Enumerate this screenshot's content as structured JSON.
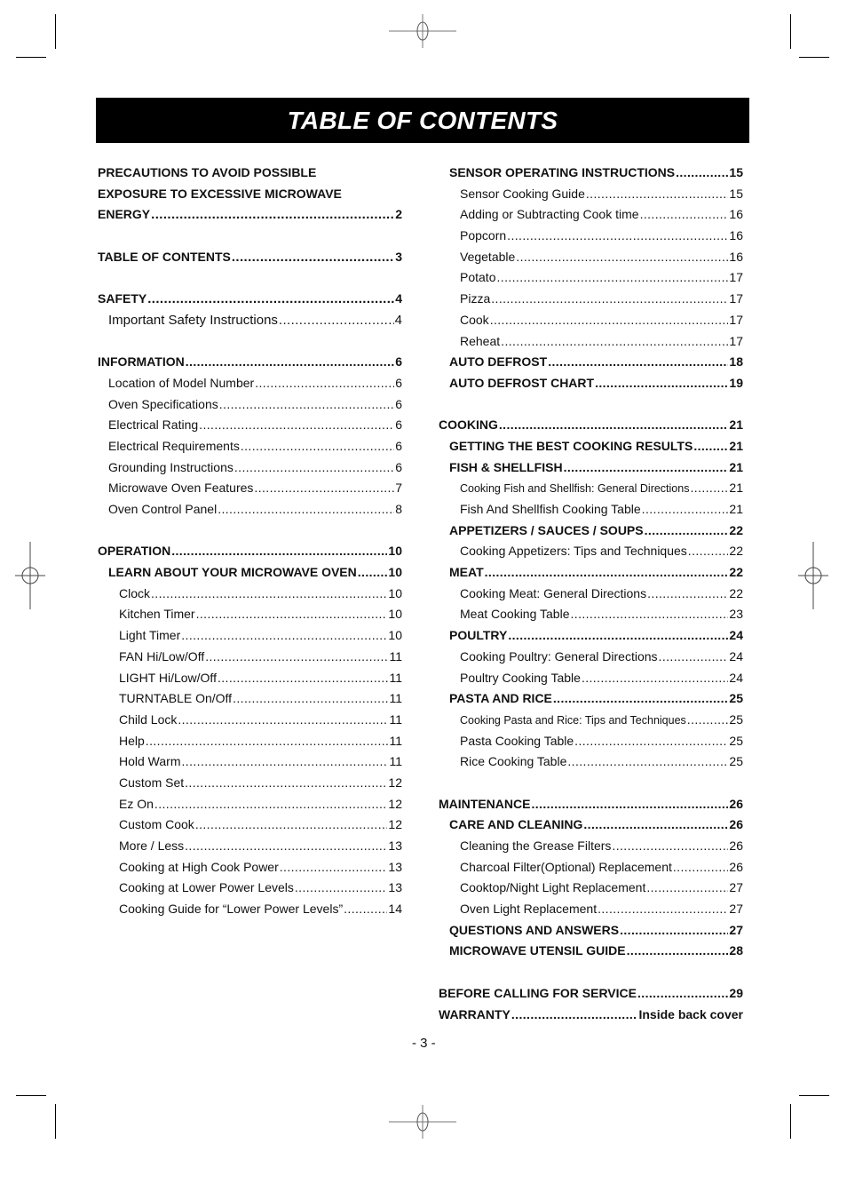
{
  "title": "TABLE OF CONTENTS",
  "page_number": "- 3 -",
  "left_column": [
    {
      "label": "PRECAUTIONS TO AVOID POSSIBLE",
      "page": "",
      "style": "b big nolead"
    },
    {
      "label": "EXPOSURE TO EXCESSIVE MICROWAVE",
      "page": "",
      "style": "b big nolead"
    },
    {
      "label": "ENERGY",
      "page": "2",
      "style": "b big"
    },
    {
      "spacer": true
    },
    {
      "label": "TABLE OF CONTENTS",
      "page": "3",
      "style": "b big"
    },
    {
      "spacer": true
    },
    {
      "label": "SAFETY",
      "page": "4",
      "style": "b big"
    },
    {
      "label": "Important Safety Instructions",
      "page": "4",
      "style": "lvl1 big"
    },
    {
      "spacer": true
    },
    {
      "label": "INFORMATION",
      "page": "6",
      "style": "b"
    },
    {
      "label": "Location of Model Number",
      "page": "6",
      "style": "lvl1"
    },
    {
      "label": "Oven Specifications",
      "page": "6",
      "style": "lvl1"
    },
    {
      "label": "Electrical Rating",
      "page": "6",
      "style": "lvl1"
    },
    {
      "label": "Electrical Requirements",
      "page": "6",
      "style": "lvl1"
    },
    {
      "label": "Grounding Instructions",
      "page": "6",
      "style": "lvl1"
    },
    {
      "label": "Microwave Oven Features",
      "page": "7",
      "style": "lvl1"
    },
    {
      "label": "Oven Control Panel",
      "page": "8",
      "style": "lvl1"
    },
    {
      "spacer": true
    },
    {
      "label": "OPERATION",
      "page": "10",
      "style": "b"
    },
    {
      "label": "LEARN ABOUT YOUR MICROWAVE OVEN",
      "page": "10",
      "style": "b lvl1"
    },
    {
      "label": "Clock",
      "page": "10",
      "style": "lvl2"
    },
    {
      "label": "Kitchen Timer",
      "page": "10",
      "style": "lvl2"
    },
    {
      "label": "Light Timer",
      "page": "10",
      "style": "lvl2"
    },
    {
      "label": "FAN Hi/Low/Off",
      "page": "11",
      "style": "lvl2"
    },
    {
      "label": "LIGHT Hi/Low/Off",
      "page": "11",
      "style": "lvl2"
    },
    {
      "label": "TURNTABLE On/Off",
      "page": "11",
      "style": "lvl2"
    },
    {
      "label": "Child Lock",
      "page": "11",
      "style": "lvl2"
    },
    {
      "label": "Help",
      "page": "11",
      "style": "lvl2"
    },
    {
      "label": "Hold Warm",
      "page": "11",
      "style": "lvl2"
    },
    {
      "label": "Custom Set",
      "page": "12",
      "style": "lvl2"
    },
    {
      "label": "Ez On",
      "page": "12",
      "style": "lvl2"
    },
    {
      "label": "Custom Cook",
      "page": "12",
      "style": "lvl2"
    },
    {
      "label": "More / Less",
      "page": "13",
      "style": "lvl2"
    },
    {
      "label": "Cooking at High Cook Power",
      "page": "13",
      "style": "lvl2"
    },
    {
      "label": "Cooking at Lower Power Levels",
      "page": "13",
      "style": "lvl2"
    },
    {
      "label": "Cooking Guide for “Lower Power Levels”",
      "page": "14",
      "style": "lvl2"
    }
  ],
  "right_column": [
    {
      "label": "SENSOR OPERATING INSTRUCTIONS",
      "page": "15",
      "style": "b lvl1"
    },
    {
      "label": "Sensor Cooking Guide",
      "page": "15",
      "style": "lvl2"
    },
    {
      "label": "Adding or Subtracting Cook time",
      "page": "16",
      "style": "lvl2"
    },
    {
      "label": "Popcorn",
      "page": "16",
      "style": "lvl2"
    },
    {
      "label": "Vegetable",
      "page": "16",
      "style": "lvl2"
    },
    {
      "label": "Potato",
      "page": "17",
      "style": "lvl2"
    },
    {
      "label": "Pizza",
      "page": "17",
      "style": "lvl2"
    },
    {
      "label": "Cook",
      "page": "17",
      "style": "lvl2"
    },
    {
      "label": "Reheat",
      "page": "17",
      "style": "lvl2"
    },
    {
      "label": "AUTO DEFROST",
      "page": "18",
      "style": "b lvl1"
    },
    {
      "label": "AUTO DEFROST CHART",
      "page": "19",
      "style": "b lvl1"
    },
    {
      "spacer": true
    },
    {
      "label": "COOKING",
      "page": "21",
      "style": "b"
    },
    {
      "label": "GETTING THE BEST COOKING RESULTS",
      "page": "21",
      "style": "b lvl1"
    },
    {
      "label": "FISH & SHELLFISH",
      "page": "21",
      "style": "b lvl1"
    },
    {
      "label": "Cooking Fish and Shellfish: General Directions",
      "page": "21",
      "style": "lvl2 small"
    },
    {
      "label": "Fish And Shellfish Cooking Table",
      "page": "21",
      "style": "lvl2"
    },
    {
      "label": "APPETIZERS / SAUCES / SOUPS",
      "page": "22",
      "style": "b lvl1"
    },
    {
      "label": "Cooking Appetizers: Tips and Techniques",
      "page": "22",
      "style": "lvl2"
    },
    {
      "label": "MEAT",
      "page": "22",
      "style": "b lvl1"
    },
    {
      "label": "Cooking Meat: General Directions",
      "page": "22",
      "style": "lvl2"
    },
    {
      "label": "Meat Cooking Table",
      "page": "23",
      "style": "lvl2"
    },
    {
      "label": "POULTRY",
      "page": "24",
      "style": "b lvl1"
    },
    {
      "label": "Cooking Poultry: General Directions",
      "page": "24",
      "style": "lvl2"
    },
    {
      "label": "Poultry Cooking Table",
      "page": "24",
      "style": "lvl2"
    },
    {
      "label": "PASTA AND RICE",
      "page": "25",
      "style": "b lvl1"
    },
    {
      "label": "Cooking Pasta and Rice: Tips and Techniques",
      "page": "25",
      "style": "lvl2 small"
    },
    {
      "label": "Pasta Cooking Table",
      "page": "25",
      "style": "lvl2"
    },
    {
      "label": "Rice Cooking Table",
      "page": "25",
      "style": "lvl2"
    },
    {
      "spacer": true
    },
    {
      "label": "MAINTENANCE",
      "page": "26",
      "style": "b"
    },
    {
      "label": "CARE AND CLEANING",
      "page": "26",
      "style": "b lvl1"
    },
    {
      "label": "Cleaning the Grease Filters",
      "page": "26",
      "style": "lvl2"
    },
    {
      "label": "Charcoal Filter(Optional) Replacement",
      "page": "26",
      "style": "lvl2"
    },
    {
      "label": "Cooktop/Night Light Replacement",
      "page": "27",
      "style": "lvl2"
    },
    {
      "label": "Oven Light Replacement",
      "page": "27",
      "style": "lvl2"
    },
    {
      "label": "QUESTIONS AND ANSWERS",
      "page": "27",
      "style": "b lvl1"
    },
    {
      "label": "MICROWAVE UTENSIL GUIDE",
      "page": "28",
      "style": "b lvl1"
    },
    {
      "spacer": true
    },
    {
      "label": "BEFORE CALLING FOR SERVICE",
      "page": "29",
      "style": "b"
    },
    {
      "label": "WARRANTY",
      "page": "Inside back cover",
      "style": "b"
    }
  ]
}
